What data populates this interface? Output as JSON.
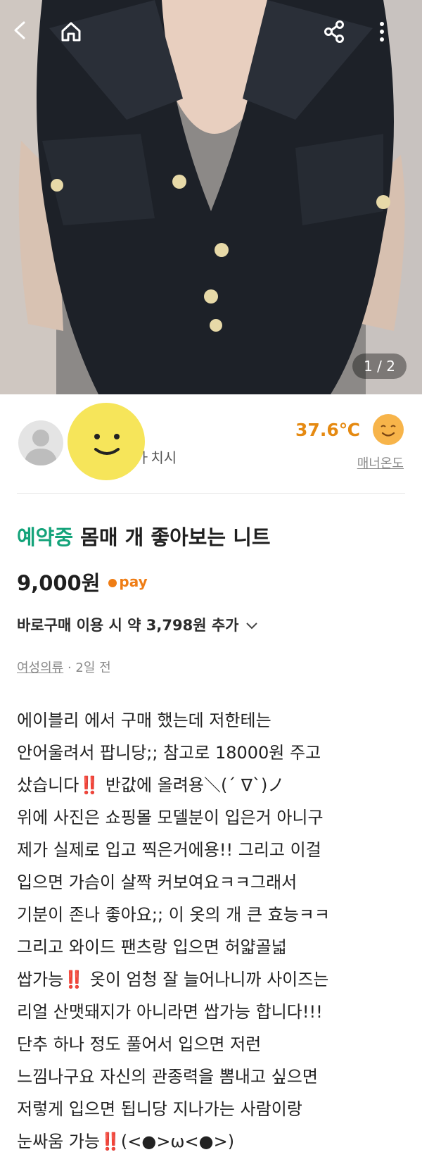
{
  "gallery": {
    "counter": "1 / 2"
  },
  "seller": {
    "location": "ㅏ치시",
    "temperature": "37.6℃",
    "manner_label": "매너온도"
  },
  "listing": {
    "status": "예약중",
    "title": "몸매 개 좋아보는 니트",
    "price": "9,000원",
    "pay_label": "pay",
    "direct_purchase": "바로구매 이용 시 약 3,798원 추가",
    "category": "여성의류",
    "time": " · 2일 전"
  },
  "description": [
    "에이블리 에서 구매 했는데 저한테는",
    "안어울려서 팝니당;; 참고로 18000원 주고",
    "샀습니다‼️ 반값에 올려용＼(´ ∇`)ノ",
    "위에 사진은 쇼핑몰 모델분이 입은거 아니구",
    "제가 실제로 입고 찍은거에용!!  그리고 이걸",
    "입으면 가슴이 살짝 커보여요ㅋㅋ그래서",
    "기분이 존나 좋아요;;  이 옷의 개 큰 효능ㅋㅋ",
    "그리고 와이드 팬츠랑 입으면 허얇골넓",
    "쌉가능‼️ 옷이 엄청 잘 늘어나니까 사이즈는",
    "리얼 산맷돼지가 아니라면 쌉가능 합니다!!!",
    "단추 하나 정도 풀어서 입으면 저런",
    "느낌나구요 자신의 관종력을 뽐내고 싶으면",
    "저렇게 입으면 됩니당 지나가는 사람이랑",
    "눈싸움 가능‼️(<●>ω<●>)"
  ]
}
